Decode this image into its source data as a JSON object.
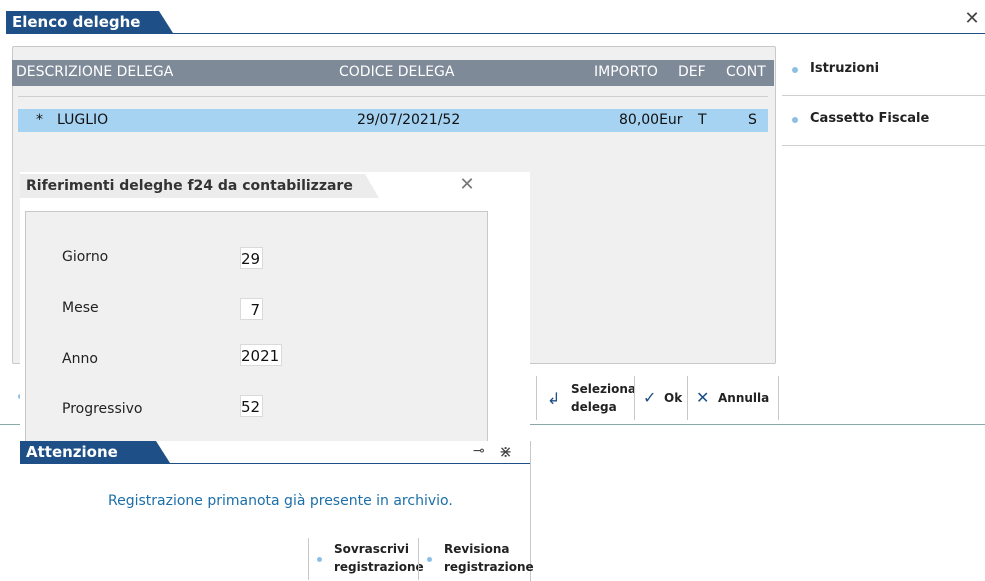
{
  "main_window": {
    "title": "Elenco deleghe",
    "close_icon": "close-icon",
    "grid": {
      "columns": [
        "DESCRIZIONE DELEGA",
        "CODICE DELEGA",
        "IMPORTO",
        "DEF",
        "CONT"
      ],
      "rows": [
        {
          "marker": "*",
          "descrizione": "LUGLIO",
          "codice": "29/07/2021/52",
          "importo": "80,00Eur",
          "def": "T",
          "cont": "S",
          "selected": true
        }
      ]
    },
    "side_menu": [
      {
        "label": "Istruzioni"
      },
      {
        "label": "Cassetto Fiscale"
      }
    ],
    "toolbar": {
      "seleziona_line1": "Seleziona",
      "seleziona_line2": "delega",
      "ok": "Ok",
      "annulla": "Annulla"
    }
  },
  "riferimenti_dialog": {
    "title": "Riferimenti deleghe f24 da contabilizzare",
    "fields": [
      {
        "label": "Giorno",
        "value": "29"
      },
      {
        "label": "Mese",
        "value": "7"
      },
      {
        "label": "Anno",
        "value": "2021"
      },
      {
        "label": "Progressivo",
        "value": "52"
      }
    ]
  },
  "attenzione_dialog": {
    "title": "Attenzione",
    "message": "Registrazione primanota già presente in archivio.",
    "buttons": [
      {
        "line1": "Sovrascrivi",
        "line2": "registrazione"
      },
      {
        "line1": "Revisiona",
        "line2": "registrazione"
      }
    ]
  },
  "colors": {
    "title_bar": "#1e4f86",
    "grid_header": "#7f8a99",
    "row_selected": "#a6d3f2",
    "message": "#1c6fa8"
  }
}
